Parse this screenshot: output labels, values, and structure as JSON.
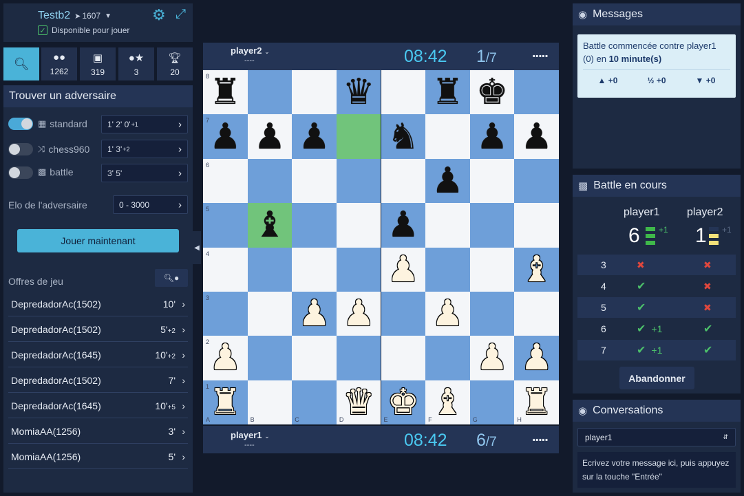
{
  "user": {
    "name": "Testb2",
    "rating_icon": "rocket-icon",
    "rating": "1607",
    "available_label": "Disponible pour jouer"
  },
  "tabs": [
    {
      "icon": "search-icon",
      "count": ""
    },
    {
      "icon": "users-icon",
      "count": "1262"
    },
    {
      "icon": "tv-icon",
      "count": "319"
    },
    {
      "icon": "friends-star-icon",
      "count": "3"
    },
    {
      "icon": "trophy-icon",
      "count": "20"
    }
  ],
  "find": {
    "title": "Trouver un adversaire",
    "modes": [
      {
        "name": "standard",
        "time_main": "1'  2'  0'",
        "time_inc": "+1",
        "enabled": true
      },
      {
        "name": "chess960",
        "time_main": "1'  3'",
        "time_inc": "+2",
        "enabled": false
      },
      {
        "name": "battle",
        "time_main": "3'  5'",
        "time_inc": "",
        "enabled": false
      }
    ],
    "elo_label": "Elo de l'adversaire",
    "elo_range": "0 - 3000",
    "play_button": "Jouer maintenant"
  },
  "offers": {
    "title": "Offres de jeu",
    "items": [
      {
        "player": "DepredadorAc(1502)",
        "time": "10'",
        "inc": ""
      },
      {
        "player": "DepredadorAc(1502)",
        "time": "5'",
        "inc": "+2"
      },
      {
        "player": "DepredadorAc(1645)",
        "time": "10'",
        "inc": "+2"
      },
      {
        "player": "DepredadorAc(1502)",
        "time": "7'",
        "inc": ""
      },
      {
        "player": "DepredadorAc(1645)",
        "time": "10'",
        "inc": "+5"
      },
      {
        "player": "MomiaAA(1256)",
        "time": "3'",
        "inc": ""
      },
      {
        "player": "MomiaAA(1256)",
        "time": "5'",
        "inc": ""
      }
    ]
  },
  "top_player": {
    "name": "player2",
    "rating": "----",
    "clock": "08:42",
    "game_num": "1",
    "game_total": "/7",
    "menu": "....."
  },
  "bottom_player": {
    "name": "player1",
    "rating": "----",
    "clock": "08:42",
    "game_num": "6",
    "game_total": "/7",
    "menu": "....."
  },
  "board": {
    "ranks": [
      "8",
      "7",
      "6",
      "5",
      "4",
      "3",
      "2",
      "1"
    ],
    "files": [
      "A",
      "B",
      "C",
      "D",
      "E",
      "F",
      "G",
      "H"
    ],
    "highlight": [
      "d7",
      "b5"
    ],
    "pieces": [
      {
        "sq": "a8",
        "p": "bR"
      },
      {
        "sq": "d8",
        "p": "bQ"
      },
      {
        "sq": "f8",
        "p": "bR"
      },
      {
        "sq": "g8",
        "p": "bK"
      },
      {
        "sq": "a7",
        "p": "bP"
      },
      {
        "sq": "b7",
        "p": "bP"
      },
      {
        "sq": "c7",
        "p": "bP"
      },
      {
        "sq": "e7",
        "p": "bN"
      },
      {
        "sq": "g7",
        "p": "bP"
      },
      {
        "sq": "h7",
        "p": "bP"
      },
      {
        "sq": "f6",
        "p": "bP"
      },
      {
        "sq": "b5",
        "p": "bB"
      },
      {
        "sq": "e5",
        "p": "bP"
      },
      {
        "sq": "e4",
        "p": "wP"
      },
      {
        "sq": "h4",
        "p": "wB"
      },
      {
        "sq": "c3",
        "p": "wP"
      },
      {
        "sq": "d3",
        "p": "wP"
      },
      {
        "sq": "f3",
        "p": "wP"
      },
      {
        "sq": "a2",
        "p": "wP"
      },
      {
        "sq": "g2",
        "p": "wP"
      },
      {
        "sq": "h2",
        "p": "wP"
      },
      {
        "sq": "a1",
        "p": "wR"
      },
      {
        "sq": "d1",
        "p": "wQ"
      },
      {
        "sq": "e1",
        "p": "wK"
      },
      {
        "sq": "f1",
        "p": "wB"
      },
      {
        "sq": "h1",
        "p": "wR"
      }
    ]
  },
  "messages": {
    "title": "Messages",
    "text_prefix": "Battle commencée contre player1",
    "text_line2_prefix": "(0) en ",
    "text_bold": "10 minute(s)",
    "votes": [
      {
        "icon": "thumbs-up-icon",
        "value": "+0"
      },
      {
        "icon": "half-icon",
        "label": "½",
        "value": "+0"
      },
      {
        "icon": "thumbs-down-icon",
        "value": "+0"
      }
    ]
  },
  "battle": {
    "title": "Battle en cours",
    "p1": {
      "name": "player1",
      "score": "6",
      "bonus": "+1"
    },
    "p2": {
      "name": "player2",
      "score": "1",
      "bonus": "+1"
    },
    "rows": [
      {
        "n": "3",
        "a": "loss",
        "a_bonus": "",
        "b": "loss",
        "b_bonus": ""
      },
      {
        "n": "4",
        "a": "win",
        "a_bonus": "",
        "b": "loss",
        "b_bonus": ""
      },
      {
        "n": "5",
        "a": "win",
        "a_bonus": "",
        "b": "loss",
        "b_bonus": ""
      },
      {
        "n": "6",
        "a": "win",
        "a_bonus": "+1",
        "b": "win",
        "b_bonus": ""
      },
      {
        "n": "7",
        "a": "win",
        "a_bonus": "+1",
        "b": "win",
        "b_bonus": ""
      }
    ],
    "resign_button": "Abandonner"
  },
  "conversations": {
    "title": "Conversations",
    "selected": "player1",
    "placeholder": "Ecrivez votre message ici, puis appuyez sur la touche \"Entrée\""
  },
  "colors": {
    "accent": "#4ab3d8",
    "board_dark": "#6e9fd9",
    "board_light": "#f4f6f9",
    "highlight": "#71c47b",
    "clock": "#4ac8f0"
  }
}
